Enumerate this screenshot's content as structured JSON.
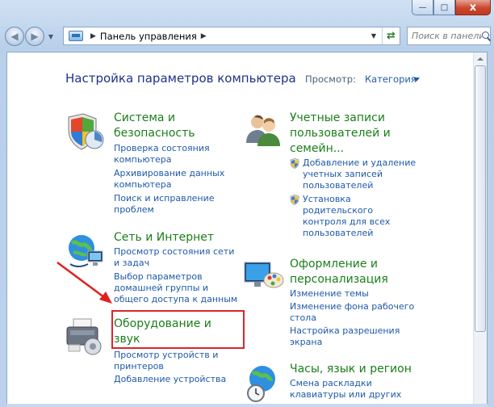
{
  "window": {
    "caption_minimize": "—",
    "caption_maximize": "□",
    "caption_close": "x"
  },
  "address_bar": {
    "path": "Панель управления"
  },
  "search": {
    "placeholder": "Поиск в панели управления"
  },
  "main": {
    "heading": "Настройка параметров компьютера",
    "view_by_label": "Просмотр:",
    "view_by_value": "Категория"
  },
  "categories": [
    {
      "title_line1": "Система и",
      "title_line2": "безопасность",
      "links": [
        [
          "Проверка состояния",
          "компьютера"
        ],
        [
          "Архивирование данных",
          "компьютера"
        ],
        [
          "Поиск и исправление",
          "проблем"
        ]
      ]
    },
    {
      "title_line1": "Сеть и Интернет",
      "links": [
        [
          "Просмотр состояния сети",
          "и задач"
        ],
        [
          "Выбор параметров",
          "домашней группы и",
          "общего доступа к данным"
        ]
      ]
    },
    {
      "title_line1": "Оборудование и",
      "title_line2": "звук",
      "links": [
        [
          "Просмотр устройств и",
          "принтеров"
        ],
        [
          "Добавление устройства"
        ]
      ]
    },
    {
      "title_line1": "Учетные записи",
      "title_line2": "пользователей и",
      "title_line3": "семейн...",
      "links": [
        [
          "Добавление и удаление",
          "учетных записей",
          "пользователей"
        ],
        [
          "Установка",
          "родительского",
          "контроля для всех",
          "пользователей"
        ]
      ]
    },
    {
      "title_line1": "Оформление и",
      "title_line2": "персонализация",
      "links": [
        [
          "Изменение темы"
        ],
        [
          "Изменение фона рабочего",
          "стола"
        ],
        [
          "Настройка разрешения",
          "экрана"
        ]
      ]
    },
    {
      "title_line1": "Часы, язык и регион",
      "links": [
        [
          "Смена раскладки",
          "клавиатуры или других"
        ]
      ]
    }
  ],
  "colors": {
    "category_title": "#1a7f1a",
    "link": "#1e5aa8",
    "heading": "#1e3287",
    "highlight": "#d8262b"
  },
  "icons": [
    "back-arrow-icon",
    "forward-arrow-icon",
    "control-panel-icon",
    "refresh-icon",
    "search-icon",
    "shield-icon",
    "users-icon",
    "network-globe-icon",
    "monitor-palette-icon",
    "printer-icon",
    "clock-globe-icon",
    "system-shield-icon"
  ]
}
